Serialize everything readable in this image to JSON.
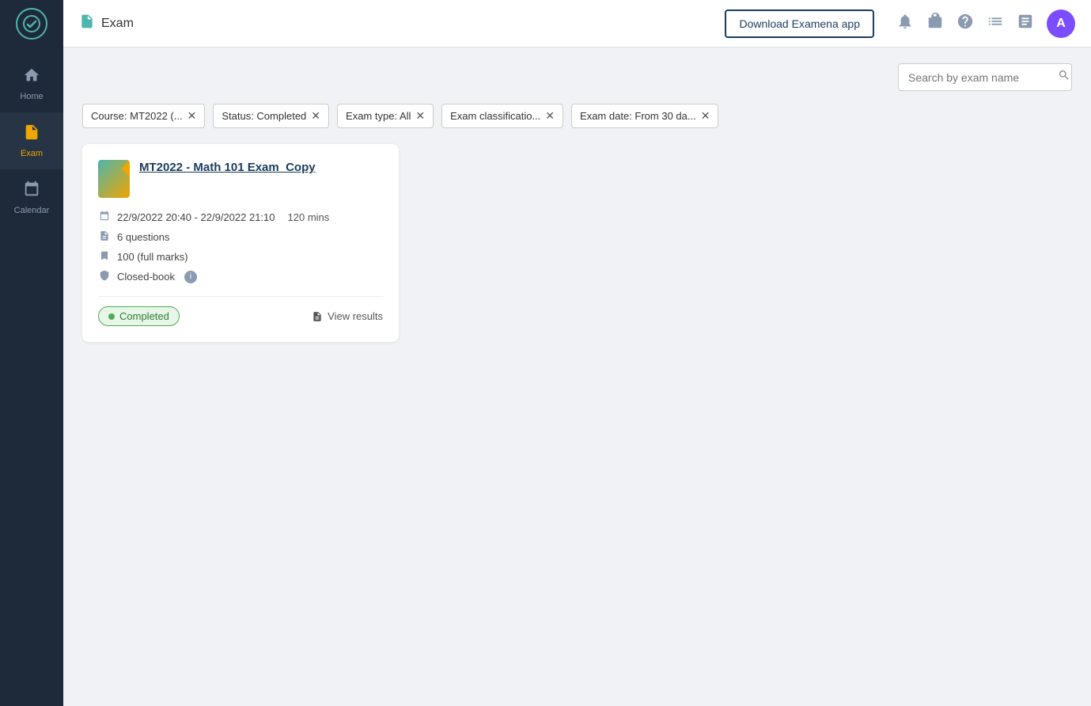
{
  "sidebar": {
    "logo": "✓",
    "items": [
      {
        "id": "home",
        "label": "Home",
        "icon": "⊞",
        "active": false
      },
      {
        "id": "exam",
        "label": "Exam",
        "icon": "📋",
        "active": true
      },
      {
        "id": "calendar",
        "label": "Calendar",
        "icon": "📅",
        "active": false
      }
    ]
  },
  "topbar": {
    "page_icon": "📝",
    "page_title": "Exam",
    "download_button": "Download Examena app",
    "search_placeholder": "Search by exam name"
  },
  "filters": [
    {
      "id": "course",
      "label": "Course: MT2022 (..."
    },
    {
      "id": "status",
      "label": "Status: Completed"
    },
    {
      "id": "exam_type",
      "label": "Exam type: All"
    },
    {
      "id": "exam_classification",
      "label": "Exam classificatio..."
    },
    {
      "id": "exam_date",
      "label": "Exam date: From 30 da..."
    }
  ],
  "exam_card": {
    "title": "MT2022 - Math 101 Exam_Copy",
    "date_range": "22/9/2022 20:40 - 22/9/2022 21:10",
    "duration": "120 mins",
    "questions": "6 questions",
    "marks": "100 (full marks)",
    "book_type": "Closed-book",
    "status": "Completed",
    "view_results": "View results"
  }
}
